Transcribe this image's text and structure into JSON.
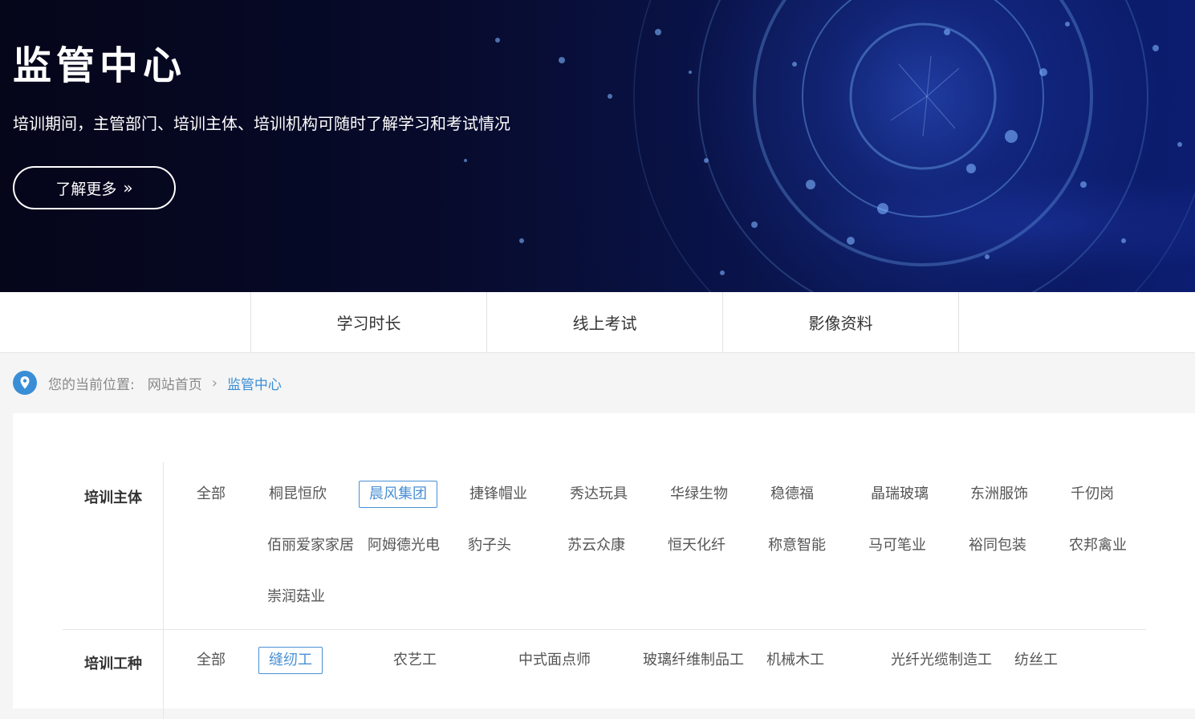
{
  "banner": {
    "title": "监管中心",
    "subtitle": "培训期间，主管部门、培训主体、培训机构可随时了解学习和考试情况",
    "button_label": "了解更多",
    "button_icon": "double-chevron-right-icon"
  },
  "tabs": [
    {
      "label": "学习时长"
    },
    {
      "label": "线上考试"
    },
    {
      "label": "影像资料"
    }
  ],
  "breadcrumb": {
    "icon": "location-pin-icon",
    "label": "您的当前位置:",
    "home": "网站首页",
    "separator": "›",
    "current": "监管中心"
  },
  "filters": {
    "subjects": {
      "label": "培训主体",
      "selected": "晨风集团",
      "items": [
        "全部",
        "桐昆恒欣",
        "晨风集团",
        "捷锋帽业",
        "秀达玩具",
        "华绿生物",
        "稳德福",
        "晶瑞玻璃",
        "东洲服饰",
        "千仞岗",
        "佰丽爱家家居",
        "阿姆德光电",
        "豹子头",
        "苏云众康",
        "恒天化纤",
        "称意智能",
        "马可笔业",
        "裕同包装",
        "农邦禽业",
        "崇润菇业"
      ]
    },
    "trades": {
      "label": "培训工种",
      "selected": "缝纫工",
      "items": [
        "全部",
        "缝纫工",
        "农艺工",
        "中式面点师",
        "玻璃纤维制品工",
        "机械木工",
        "光纤光缆制造工",
        "纺丝工"
      ]
    }
  },
  "colors": {
    "accent": "#4a90d6",
    "banner_bg": "#070a2a",
    "page_bg": "#f5f5f5"
  }
}
